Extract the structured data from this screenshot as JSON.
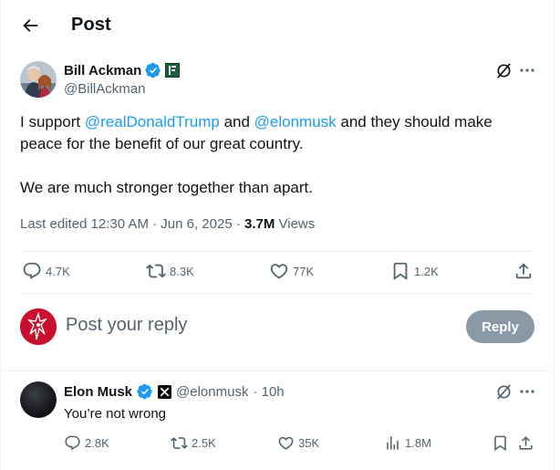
{
  "header": {
    "title": "Post"
  },
  "tweet": {
    "author_name": "Bill Ackman",
    "author_handle": "@BillAckman",
    "text_1": "I support ",
    "mention_1": "@realDonaldTrump",
    "text_2": " and ",
    "mention_2": "@elonmusk",
    "text_3": " and they should make peace for the benefit of our great country.",
    "text_4": "We are much stronger together than apart.",
    "meta_edited": "Last edited 12:30 AM · Jun 6, 2025 · ",
    "meta_views_count": "3.7M",
    "meta_views_label": " Views",
    "replies": "4.7K",
    "reposts": "8.3K",
    "likes": "77K",
    "bookmarks": "1.2K"
  },
  "reply_composer": {
    "placeholder": "Post your reply",
    "button_label": "Reply"
  },
  "reply": {
    "author_name": "Elon Musk",
    "author_handle": "@elonmusk",
    "time": "· 10h",
    "text": "You’re not wrong",
    "replies": "2.8K",
    "reposts": "2.5K",
    "likes": "35K",
    "views": "1.8M"
  },
  "colors": {
    "accent": "#1d9bf0",
    "muted": "#536471",
    "reply_button": "#8b98a5"
  }
}
